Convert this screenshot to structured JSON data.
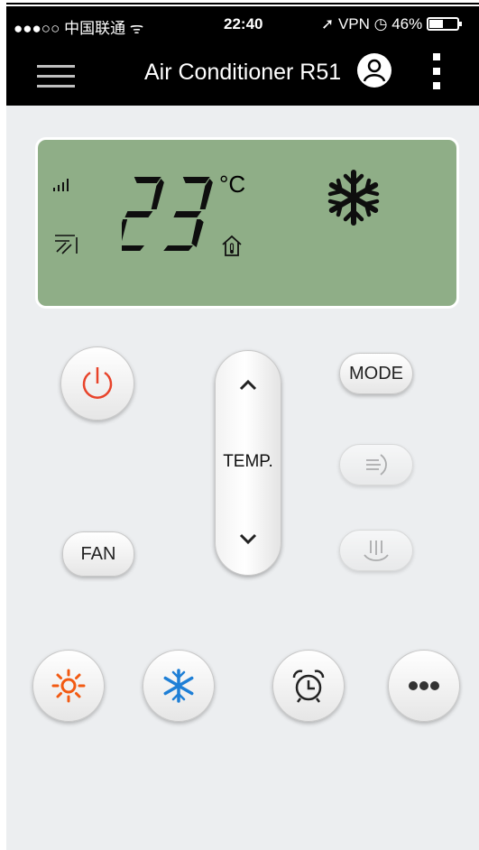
{
  "status_bar": {
    "carrier": "●●●○○ 中国联通 ᯤ",
    "time": "22:40",
    "right": "➚ VPN ◷ 46%"
  },
  "nav": {
    "title": "Air Conditioner R51"
  },
  "display": {
    "temperature": "23",
    "unit": "°C",
    "mode": "cool"
  },
  "buttons": {
    "mode": "MODE",
    "fan": "FAN",
    "temp": "TEMP."
  },
  "colors": {
    "lcd_bg": "#8fae87",
    "power_red": "#e8432a",
    "heat_orange": "#f25a12",
    "cool_blue": "#1e7fd6"
  },
  "icons": [
    "menu-icon",
    "user-icon",
    "more-vertical-icon",
    "signal-icon",
    "swing-icon",
    "home-sensor-icon",
    "snowflake-icon",
    "power-icon",
    "swing-horizontal-icon",
    "swing-vertical-icon",
    "chevron-up-icon",
    "chevron-down-icon",
    "sun-icon",
    "snowflake-icon",
    "alarm-clock-icon",
    "ellipsis-icon"
  ]
}
